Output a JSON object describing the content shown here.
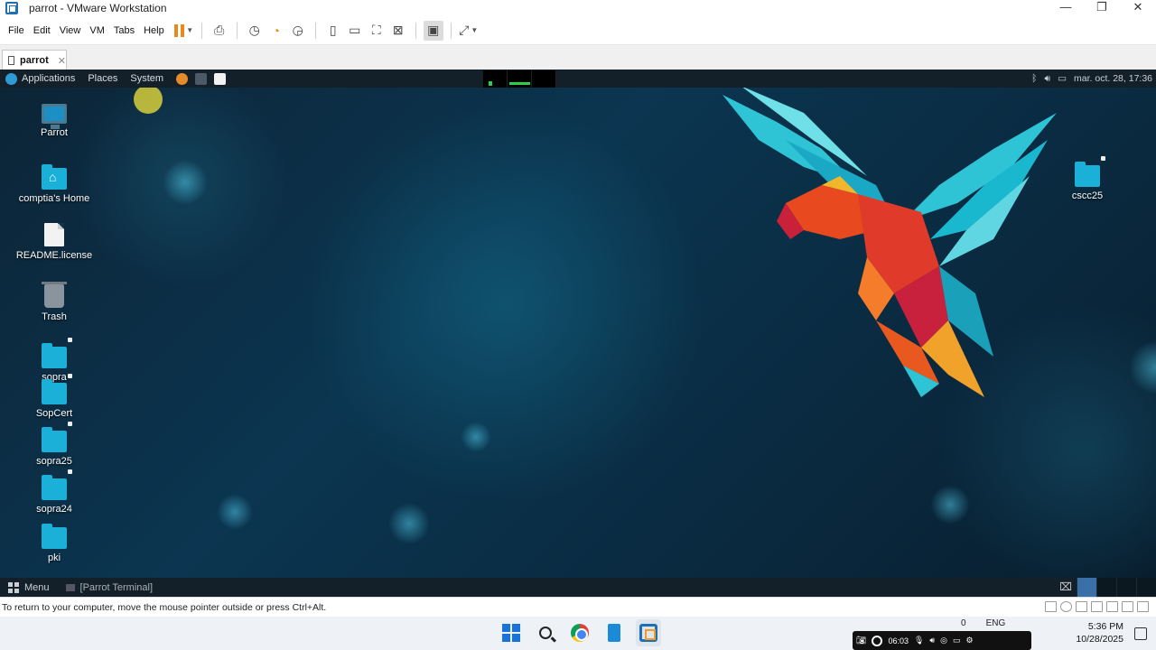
{
  "window": {
    "title": "parrot - VMware Workstation",
    "controls": [
      "—",
      "❐",
      "✕"
    ]
  },
  "menu": [
    "File",
    "Edit",
    "View",
    "VM",
    "Tabs",
    "Help"
  ],
  "vm_tab": {
    "label": "parrot",
    "close": "✕"
  },
  "guest_panel": {
    "items": [
      "Applications",
      "Places",
      "System"
    ],
    "datetime": "mar. oct. 28, 17:36"
  },
  "desktop_icons": [
    {
      "label": "Parrot",
      "icon": "computer-icon"
    },
    {
      "label": "comptia's Home",
      "icon": "home-folder-icon"
    },
    {
      "label": "README.license",
      "icon": "document-icon"
    },
    {
      "label": "Trash",
      "icon": "trash-icon"
    },
    {
      "label": "sopra",
      "icon": "folder-icon"
    },
    {
      "label": "SopCert",
      "icon": "folder-icon"
    },
    {
      "label": "sopra25",
      "icon": "folder-icon"
    },
    {
      "label": "sopra24",
      "icon": "folder-icon"
    },
    {
      "label": "pki",
      "icon": "folder-icon"
    },
    {
      "label": "cscc25",
      "icon": "folder-icon"
    }
  ],
  "guest_bottom": {
    "menu": "Menu",
    "task": "[Parrot Terminal]"
  },
  "status_bar": {
    "message": "To return to your computer, move the mouse pointer outside or press Ctrl+Alt."
  },
  "taskbar": {
    "rec_time": "06:03",
    "badge": "0",
    "lang": "ENG",
    "time": "5:36 PM",
    "date": "10/28/2025"
  },
  "colors": {
    "accent": "#1f6fb5",
    "pause": "#e8891c",
    "folder": "#1ab0d8"
  }
}
